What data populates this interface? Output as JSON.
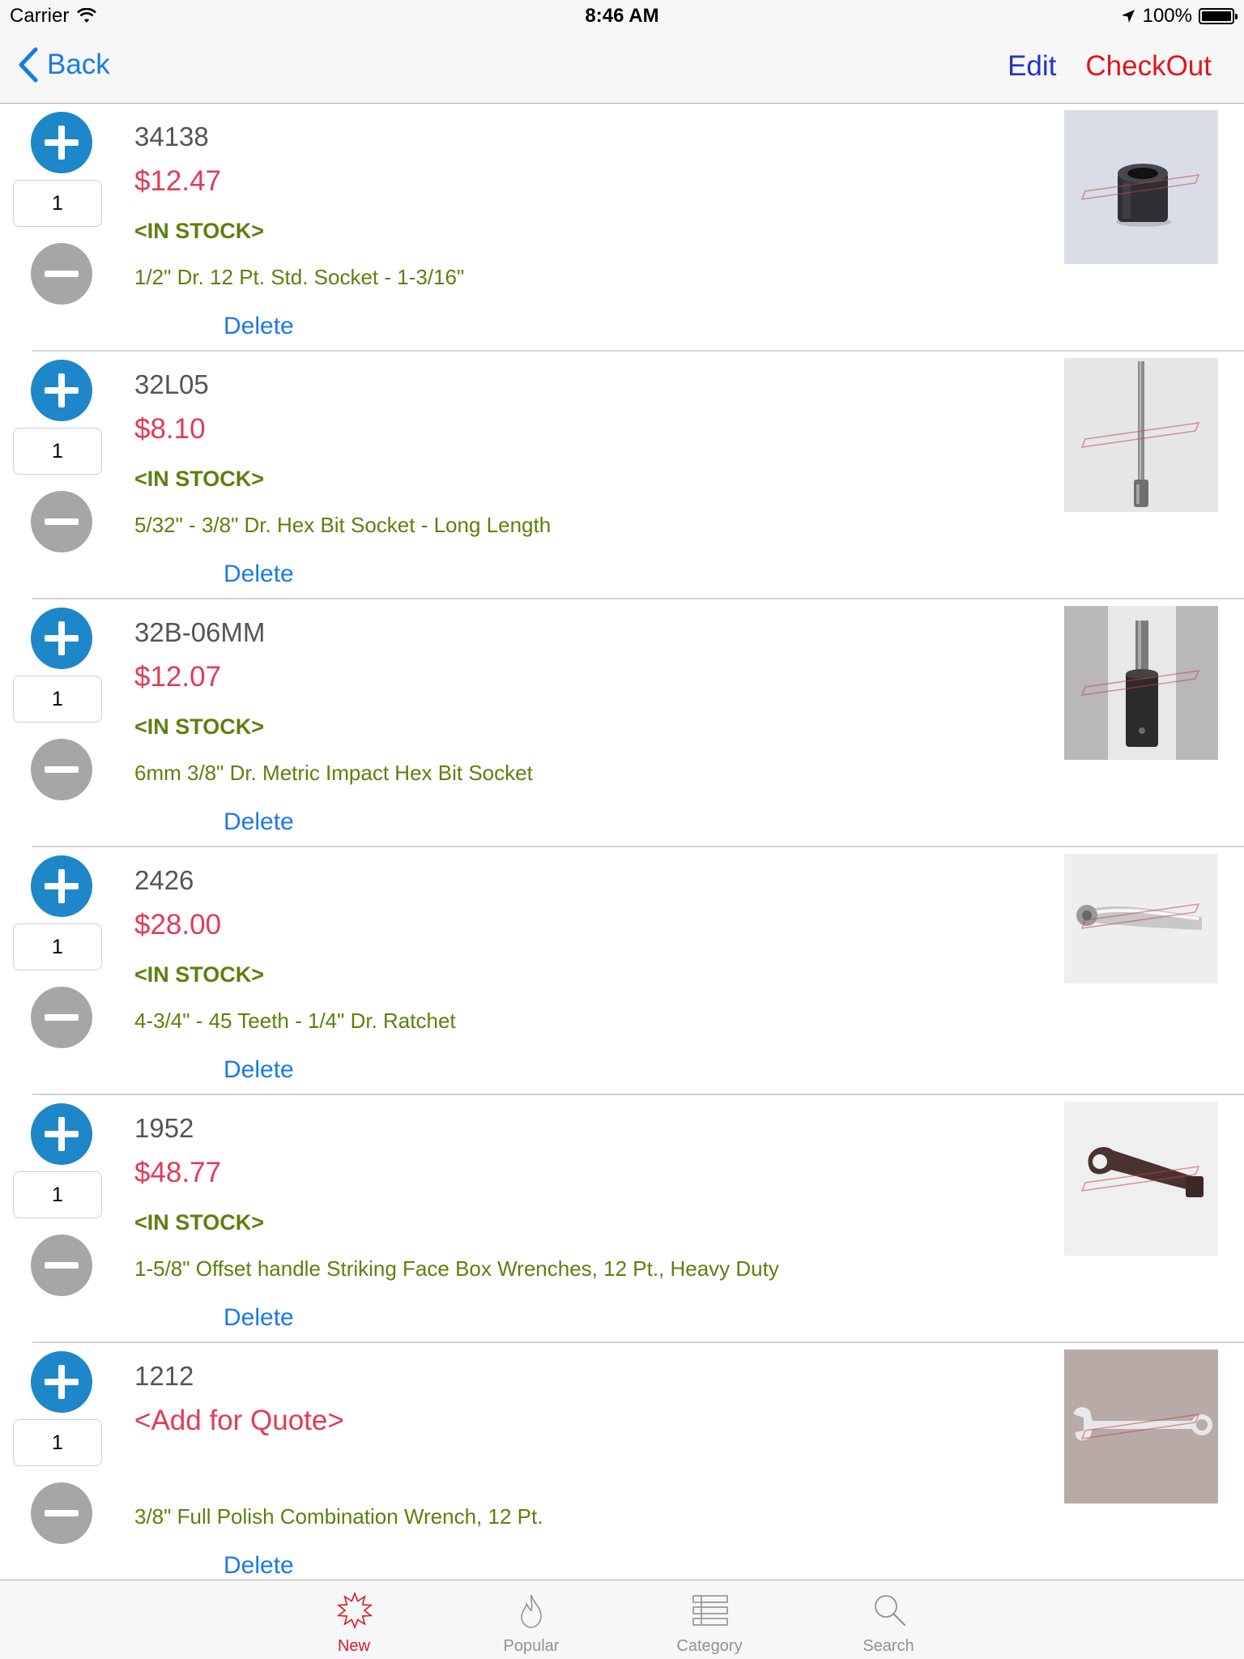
{
  "status_bar": {
    "carrier": "Carrier",
    "time": "8:46 AM",
    "battery": "100%",
    "battery_level": 1.0
  },
  "nav": {
    "back_label": "Back",
    "edit_label": "Edit",
    "checkout_label": "CheckOut"
  },
  "items": [
    {
      "code": "34138",
      "price": "$12.47",
      "stock": "<IN STOCK>",
      "description": "1/2\" Dr. 12 Pt. Std. Socket - 1-3/16\"",
      "quantity": "1",
      "delete_label": "Delete",
      "image_icon": "socket-image"
    },
    {
      "code": "32L05",
      "price": "$8.10",
      "stock": "<IN STOCK>",
      "description": "5/32\" - 3/8\" Dr. Hex Bit Socket - Long Length",
      "quantity": "1",
      "delete_label": "Delete",
      "image_icon": "hex-bit-socket-image"
    },
    {
      "code": "32B-06MM",
      "price": "$12.07",
      "stock": "<IN STOCK>",
      "description": "6mm 3/8\" Dr. Metric Impact Hex Bit Socket",
      "quantity": "1",
      "delete_label": "Delete",
      "image_icon": "impact-hex-bit-socket-image"
    },
    {
      "code": "2426",
      "price": "$28.00",
      "stock": "<IN STOCK>",
      "description": "4-3/4\" - 45 Teeth - 1/4\" Dr. Ratchet",
      "quantity": "1",
      "delete_label": "Delete",
      "image_icon": "ratchet-image"
    },
    {
      "code": "1952",
      "price": "$48.77",
      "stock": "<IN STOCK>",
      "description": "1-5/8\" Offset handle Striking Face Box Wrenches, 12 Pt., Heavy Duty",
      "quantity": "1",
      "delete_label": "Delete",
      "image_icon": "striking-wrench-image"
    },
    {
      "code": "1212",
      "price": "<Add for Quote>",
      "stock": "",
      "description": "3/8\" Full Polish Combination Wrench, 12 Pt.",
      "quantity": "1",
      "delete_label": "Delete",
      "image_icon": "combination-wrench-image"
    }
  ],
  "tabs": [
    {
      "label": "New",
      "icon": "starburst-icon",
      "active": true
    },
    {
      "label": "Popular",
      "icon": "flame-icon",
      "active": false
    },
    {
      "label": "Category",
      "icon": "list-icon",
      "active": false
    },
    {
      "label": "Search",
      "icon": "magnifier-icon",
      "active": false
    }
  ],
  "colors": {
    "accent_blue": "#1a7ae6",
    "edit_blue": "#2233cc",
    "checkout_red": "#e0161b",
    "price_red": "#e23b57",
    "stock_green": "#5e7f0f",
    "plus_button": "#1e87c9",
    "minus_button": "#a6a6a6",
    "tab_active": "#d81b2a"
  }
}
